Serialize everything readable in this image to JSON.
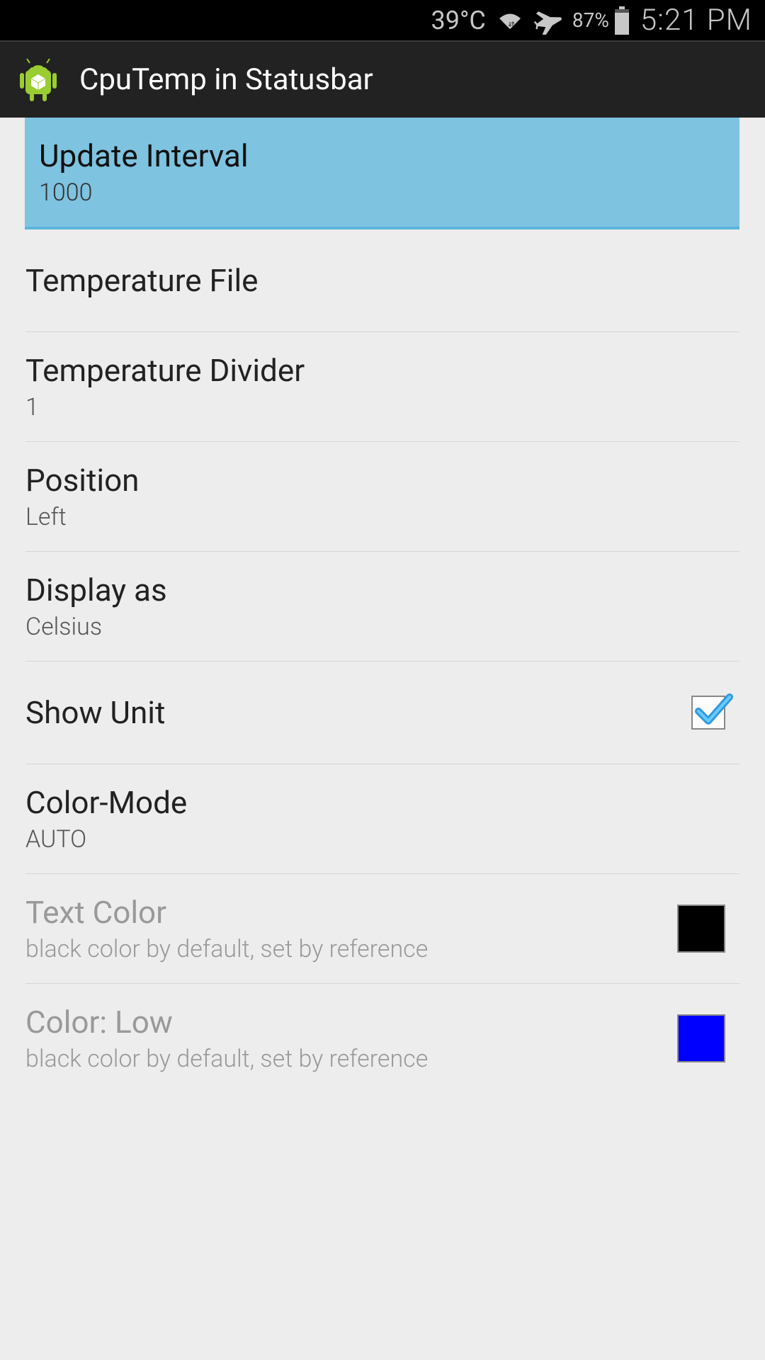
{
  "statusbar": {
    "temperature": "39°C",
    "battery_pct": "87%",
    "time": "5:21 PM"
  },
  "actionbar": {
    "title": "CpuTemp in Statusbar"
  },
  "settings": {
    "update_interval": {
      "title": "Update Interval",
      "value": "1000"
    },
    "temperature_file": {
      "title": "Temperature File"
    },
    "temperature_divider": {
      "title": "Temperature Divider",
      "value": "1"
    },
    "position": {
      "title": "Position",
      "value": "Left"
    },
    "display_as": {
      "title": "Display as",
      "value": "Celsius"
    },
    "show_unit": {
      "title": "Show Unit",
      "checked": true
    },
    "color_mode": {
      "title": "Color-Mode",
      "value": "AUTO"
    },
    "text_color": {
      "title": "Text Color",
      "summary": "black color by default, set by reference",
      "swatch": "#000000"
    },
    "color_low": {
      "title": "Color: Low",
      "summary": "black color by default, set by reference",
      "swatch": "#0000ff"
    }
  }
}
